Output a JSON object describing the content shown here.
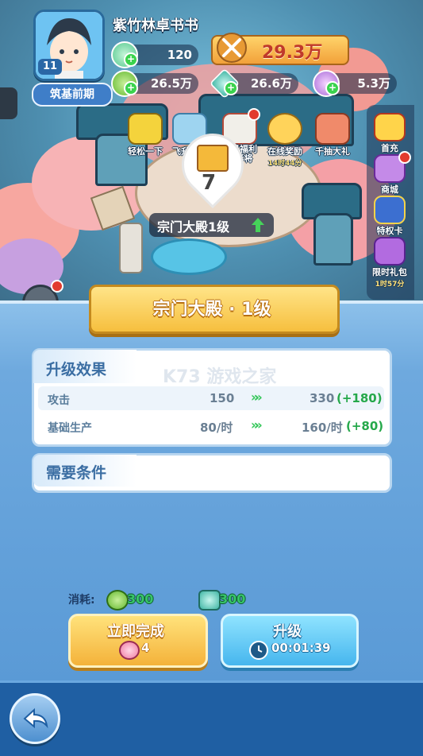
{
  "player": {
    "name": "紫竹林卓书书",
    "level": "11",
    "realm": "筑基前期"
  },
  "resources": {
    "stamina": "120",
    "power": "29.3万",
    "herb": "26.5万",
    "crystal": "26.6万",
    "spirit": "5.3万"
  },
  "events": [
    {
      "label": "轻松一下",
      "sub": ""
    },
    {
      "label": "飞升历程",
      "sub": ""
    },
    {
      "label": "七日福利\n送彩将",
      "sub": ""
    },
    {
      "label": "在线奖励",
      "sub": "14时44分"
    },
    {
      "label": "千抽大礼",
      "sub": ""
    }
  ],
  "side_menu": [
    {
      "label": "首充",
      "sub": ""
    },
    {
      "label": "商城",
      "sub": ""
    },
    {
      "label": "特权卡",
      "sub": ""
    },
    {
      "label": "限时礼包",
      "sub": "1时57分"
    }
  ],
  "building": {
    "marker_count": "7",
    "label": "宗门大殿1级"
  },
  "panel": {
    "title": "宗门大殿 · 1级",
    "effects_header": "升级效果",
    "watermark": "K73 游戏之家",
    "stats": [
      {
        "name": "攻击",
        "current": "150",
        "next": "330",
        "inc": "(+180)"
      },
      {
        "name": "基础生产",
        "current": "80/时",
        "next": "160/时",
        "inc": "(+80)"
      }
    ],
    "requirements_header": "需要条件",
    "cost_label": "消耗:",
    "cost_herb": "300",
    "cost_crystal": "300",
    "complete_label": "立即完成",
    "complete_cost": "4",
    "upgrade_label": "升级",
    "upgrade_timer": "00:01:39"
  },
  "colors": {
    "accent_gold": "#f4b23a",
    "accent_blue": "#46b6ee",
    "increase_green": "#25a84a"
  }
}
